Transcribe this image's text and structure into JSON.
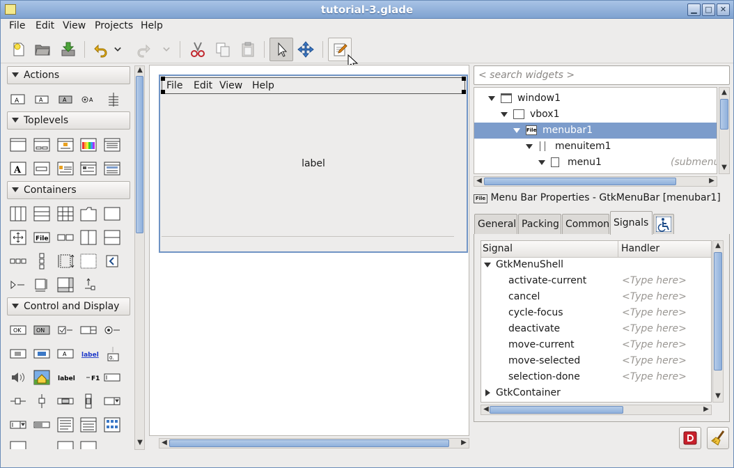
{
  "window": {
    "title": "tutorial-3.glade",
    "controls": {
      "minimize": "▁",
      "maximize": "□",
      "close": "✕"
    }
  },
  "menu": [
    "File",
    "Edit",
    "View",
    "Projects",
    "Help"
  ],
  "toolbar": {
    "icons": [
      "new-icon",
      "open-icon",
      "save-icon",
      "undo-icon",
      "undo-history-icon",
      "redo-icon",
      "redo-history-icon",
      "cut-icon",
      "copy-icon",
      "paste-icon",
      "select-pointer-icon",
      "drag-resize-icon",
      "edit-icon"
    ]
  },
  "palette": {
    "groups": [
      {
        "label": "Actions"
      },
      {
        "label": "Toplevels"
      },
      {
        "label": "Containers"
      },
      {
        "label": "Control and Display"
      }
    ],
    "widget_text": {
      "file": "File",
      "ok": "OK",
      "on": "ON",
      "a": "A",
      "label_link": "label",
      "label_plain": "label",
      "f1": "F1",
      "spin": "0."
    }
  },
  "design": {
    "menubar_items": [
      "File",
      "Edit",
      "View",
      "Help"
    ],
    "label": "label"
  },
  "inspector": {
    "search_placeholder": "< search widgets >",
    "tree": [
      {
        "name": "window1",
        "depth": 0
      },
      {
        "name": "vbox1",
        "depth": 1
      },
      {
        "name": "menubar1",
        "depth": 2,
        "selected": true,
        "icon": "File"
      },
      {
        "name": "menuitem1",
        "depth": 3
      },
      {
        "name": "menu1",
        "depth": 4,
        "note": "(submenu"
      }
    ]
  },
  "properties": {
    "icon": "File",
    "title": "Menu Bar Properties - GtkMenuBar [menubar1]",
    "tabs": [
      "General",
      "Packing",
      "Common",
      "Signals"
    ],
    "active_tab": "Signals",
    "accessibility_icon": "accessibility-icon",
    "columns": {
      "signal": "Signal",
      "handler": "Handler"
    },
    "group1": "GtkMenuShell",
    "signals": [
      "activate-current",
      "cancel",
      "cycle-focus",
      "deactivate",
      "move-current",
      "move-selected",
      "selection-done"
    ],
    "handler_placeholder": "<Type here>",
    "group2": "GtkContainer"
  },
  "bottom_buttons": [
    "devhelp-icon",
    "clear-icon"
  ]
}
